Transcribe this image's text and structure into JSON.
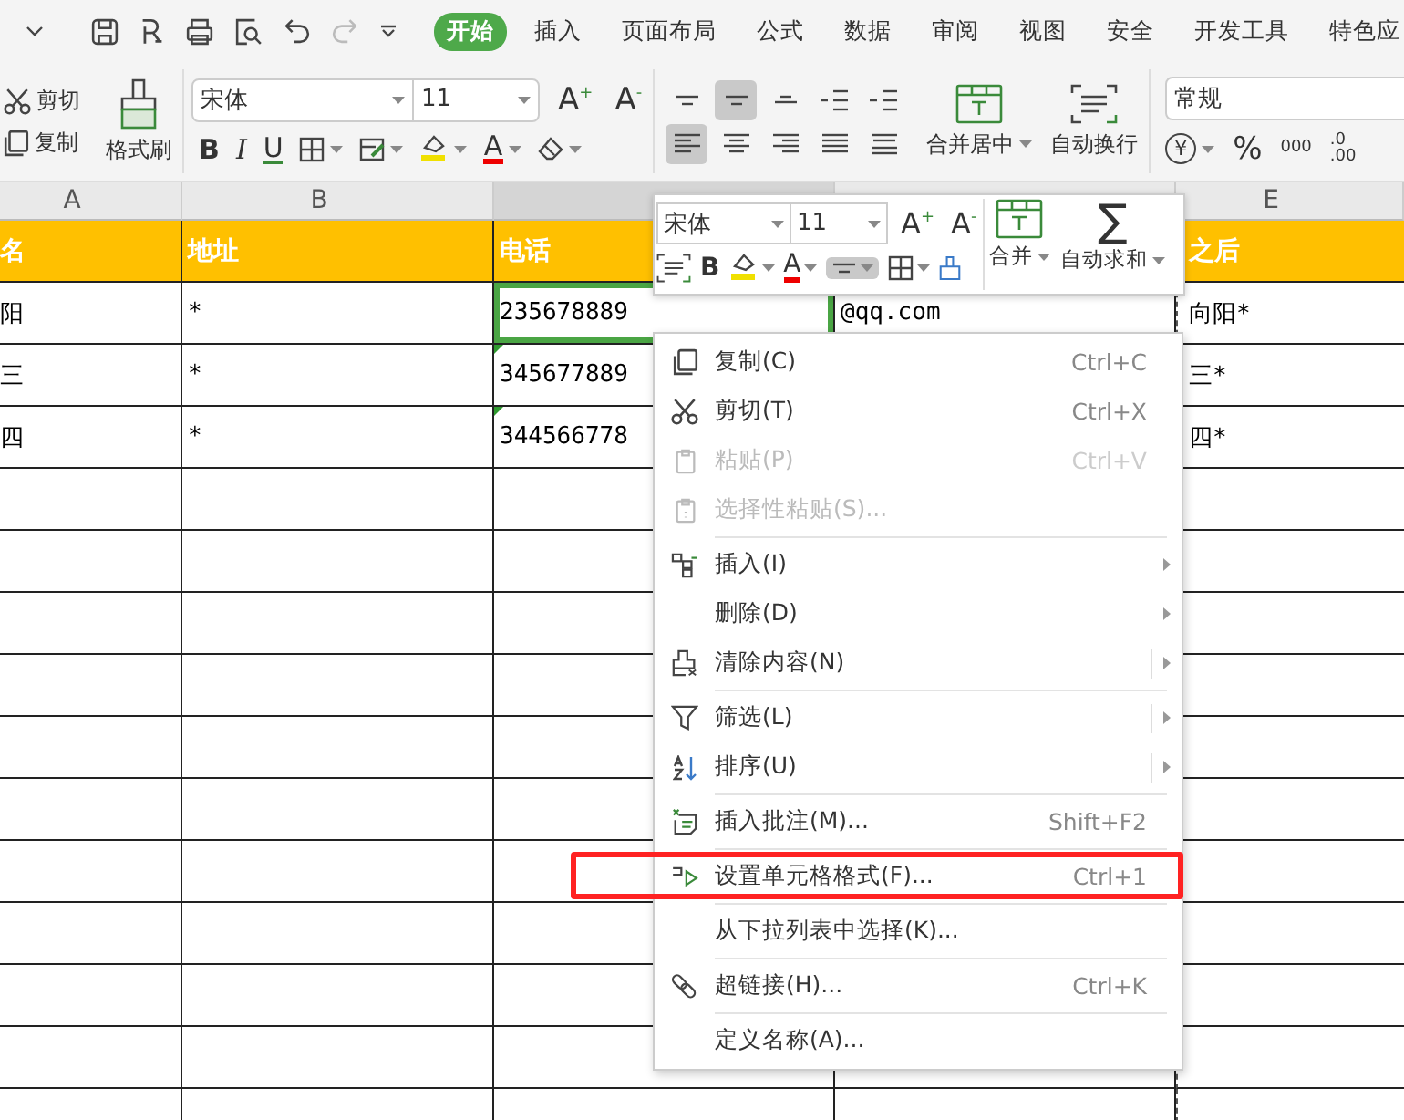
{
  "quick_access": {
    "tabs": [
      {
        "label": "开始",
        "selected": true
      },
      {
        "label": "插入",
        "selected": false
      },
      {
        "label": "页面布局",
        "selected": false
      },
      {
        "label": "公式",
        "selected": false
      },
      {
        "label": "数据",
        "selected": false
      },
      {
        "label": "审阅",
        "selected": false
      },
      {
        "label": "视图",
        "selected": false
      },
      {
        "label": "安全",
        "selected": false
      },
      {
        "label": "开发工具",
        "selected": false
      },
      {
        "label": "特色应",
        "selected": false
      }
    ]
  },
  "ribbon": {
    "clipboard": {
      "cut": "剪切",
      "copy": "复制",
      "format_painter": "格式刷"
    },
    "font": {
      "name": "宋体",
      "size": "11",
      "grow": "A$^{+}$",
      "shrink": "A$^{-}$",
      "bold": "B",
      "italic": "I",
      "underline": "U",
      "font_color": "A"
    },
    "alignment": {
      "buttons": [
        {
          "selected": false
        },
        {
          "selected": true
        },
        {
          "selected": false
        },
        {
          "selected": false
        },
        {
          "selected": false
        },
        {
          "selected": true
        },
        {
          "selected": false
        },
        {
          "selected": false
        },
        {
          "selected": false
        },
        {
          "selected": false
        }
      ],
      "merge": "合并居中",
      "wrap": "自动换行"
    },
    "number": {
      "format": "常规",
      "currency": "¥",
      "percent": "%",
      "thousands": "000",
      "decimal": [
        ".0",
        ".00"
      ]
    }
  },
  "sheet": {
    "column_headers": [
      {
        "label": "A",
        "selected": false
      },
      {
        "label": "B",
        "selected": false
      },
      {
        "selected": true
      },
      {
        "selected": false
      },
      {
        "label": "E",
        "selected": false
      }
    ],
    "rows": [
      {
        "header": true,
        "column_1": {
          "text": "名",
          "selected": false,
          "flagged": false
        },
        "column_2": {
          "text": "地址",
          "selected": false,
          "flagged": false
        },
        "column_3": {
          "text": "电话",
          "selected": false,
          "flagged": false
        },
        "column_5": {
          "text": "之后",
          "selected": false,
          "flagged": false
        }
      },
      {
        "header": false,
        "column_1": {
          "text": "阳",
          "selected": false,
          "flagged": false
        },
        "column_2": {
          "text": "*",
          "selected": false,
          "flagged": false
        },
        "column_3": {
          "text": "235678889",
          "selected": true,
          "flagged": false
        },
        "column_4": {
          "text": "@qq.com",
          "selected": false
        },
        "column_5": {
          "text": "向阳*",
          "selected": false,
          "flagged": false
        }
      },
      {
        "header": false,
        "column_1": {
          "text": "三",
          "selected": false,
          "flagged": false
        },
        "column_2": {
          "text": "*",
          "selected": false,
          "flagged": false
        },
        "column_3": {
          "text": "345677889",
          "selected": false,
          "flagged": true
        },
        "column_5": {
          "text": "三*",
          "selected": false,
          "flagged": false
        }
      },
      {
        "header": false,
        "column_1": {
          "text": "四",
          "selected": false,
          "flagged": false
        },
        "column_2": {
          "text": "*",
          "selected": false,
          "flagged": false
        },
        "column_3": {
          "text": "344566778",
          "selected": false,
          "flagged": true
        },
        "column_5": {
          "text": "四*",
          "selected": false,
          "flagged": false
        }
      }
    ]
  },
  "mini_toolbar": {
    "font_name": "宋体",
    "font_size": "11",
    "grow": "A$^{+}$",
    "shrink": "A$^{-}$",
    "bold": "B",
    "font_color": "A",
    "align_selected": true,
    "merge": "合并",
    "autosum_symbol": "∑",
    "autosum": "自动求和"
  },
  "context_menu": {
    "groups": [
      [
        {
          "label": "复制(C)",
          "shortcut": "Ctrl+C",
          "disabled": false,
          "submenu": false,
          "split": false
        },
        {
          "label": "剪切(T)",
          "shortcut": "Ctrl+X",
          "disabled": false,
          "submenu": false,
          "split": false
        },
        {
          "label": "粘贴(P)",
          "shortcut": "Ctrl+V",
          "disabled": true,
          "submenu": false,
          "split": false
        },
        {
          "label": "选择性粘贴(S)...",
          "disabled": true,
          "submenu": false,
          "split": false
        }
      ],
      [
        {
          "label": "插入(I)",
          "disabled": false,
          "submenu": true,
          "split": false
        },
        {
          "label": "删除(D)",
          "disabled": false,
          "submenu": true,
          "split": false
        },
        {
          "label": "清除内容(N)",
          "disabled": false,
          "submenu": true,
          "split": true
        }
      ],
      [
        {
          "label": "筛选(L)",
          "disabled": false,
          "submenu": true,
          "split": true
        },
        {
          "label": "排序(U)",
          "disabled": false,
          "submenu": true,
          "split": true
        }
      ],
      [
        {
          "label": "插入批注(M)...",
          "shortcut": "Shift+F2",
          "disabled": false,
          "submenu": false,
          "split": false
        }
      ],
      [
        {
          "label": "设置单元格格式(F)...",
          "shortcut": "Ctrl+1",
          "disabled": false,
          "submenu": false,
          "split": false,
          "highlighted": true
        }
      ],
      [
        {
          "label": "从下拉列表中选择(K)...",
          "disabled": false,
          "submenu": false,
          "split": false
        }
      ],
      [
        {
          "label": "超链接(H)...",
          "shortcut": "Ctrl+K",
          "disabled": false,
          "submenu": false,
          "split": false
        }
      ],
      [
        {
          "label": "定义名称(A)...",
          "disabled": false,
          "submenu": false,
          "split": false
        }
      ]
    ]
  }
}
